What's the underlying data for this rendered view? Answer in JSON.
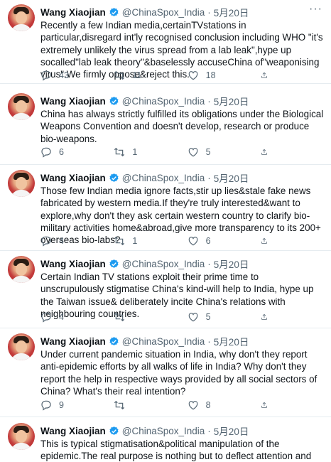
{
  "tweets": [
    {
      "author_name": "Wang Xiaojian",
      "handle": "@ChinaSpox_India",
      "separator": "·",
      "date": "5月20日",
      "text": "Recently a few Indian media,certainTVstations in particular,disregard int'ly recognised conclusion including WHO \"it's extremely unlikely the virus spread from a lab leak\",hype up socalled\"lab leak theory\"&baselessly accuseChina of\"weaponising virus\".We firmly oppose&reject this.",
      "replies": "43",
      "retweets": "11",
      "likes": "18"
    },
    {
      "author_name": "Wang Xiaojian",
      "handle": "@ChinaSpox_India",
      "separator": "·",
      "date": "5月20日",
      "text": "China has always strictly fulfilled its obligations under the Biological Weapons Convention and doesn't develop, research or produce bio-weapons.",
      "replies": "6",
      "retweets": "1",
      "likes": "5"
    },
    {
      "author_name": "Wang Xiaojian",
      "handle": "@ChinaSpox_India",
      "separator": "·",
      "date": "5月20日",
      "text": "Those few Indian media ignore facts,stir up lies&stale fake news fabricated by western media.If they're truly interested&want to explore,why don't they ask certain western country to clarify bio-military activities home&abroad,give more transparency to its 200+ overseas bio-labs?",
      "replies": "4",
      "retweets": "1",
      "likes": "6"
    },
    {
      "author_name": "Wang Xiaojian",
      "handle": "@ChinaSpox_India",
      "separator": "·",
      "date": "5月20日",
      "text": "Certain Indian TV stations exploit their prime time to unscrupulously stigmatise China's kind-will help to India, hype up the Taiwan issue& deliberately incite China's relations with neighbouring countries.",
      "replies": "4",
      "retweets": "",
      "likes": "5"
    },
    {
      "author_name": "Wang Xiaojian",
      "handle": "@ChinaSpox_India",
      "separator": "·",
      "date": "5月20日",
      "text": "Under current pandemic situation in India, why don't they report anti-epidemic efforts by all walks of life in India? Why don't they report the help in respective ways provided by all social sectors of China? What's their real intention?",
      "replies": "9",
      "retweets": "",
      "likes": "8"
    },
    {
      "author_name": "Wang Xiaojian",
      "handle": "@ChinaSpox_India",
      "separator": "·",
      "date": "5月20日",
      "text": "This is typical stigmatisation&political manipulation of the epidemic.The real purpose is nothing but to deflect attention and shift blame.We urge those",
      "replies": "",
      "retweets": "",
      "likes": ""
    }
  ],
  "more_glyph": "···",
  "colors": {
    "accent": "#1d9bf0",
    "muted": "#536471",
    "text": "#0f1419",
    "divider": "#e6ecf0"
  },
  "icons": [
    "reply-icon",
    "retweet-icon",
    "like-icon",
    "share-icon",
    "verified-badge-icon",
    "more-options-icon"
  ]
}
